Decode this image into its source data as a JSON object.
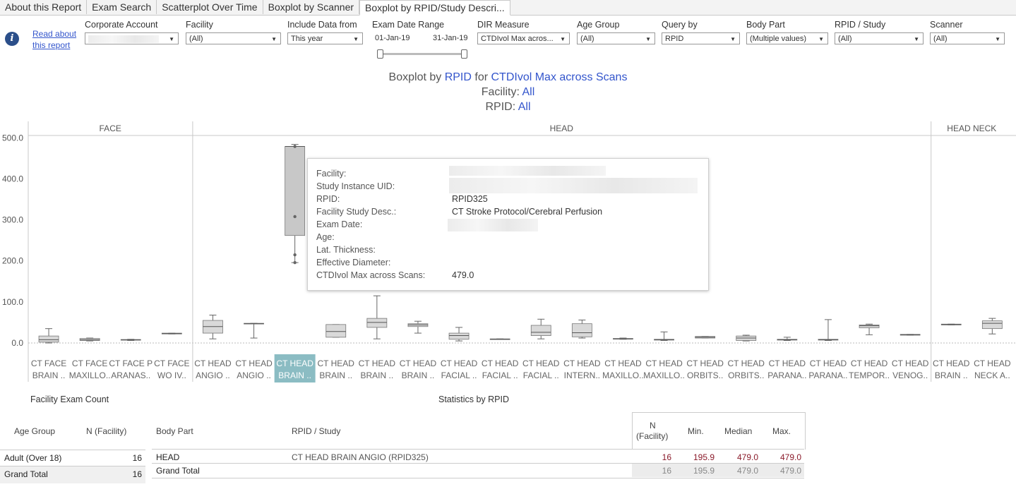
{
  "tabs": [
    "About this Report",
    "Exam Search",
    "Scatterplot Over Time",
    "Boxplot by Scanner",
    "Boxplot by RPID/Study Descri..."
  ],
  "active_tab": 4,
  "info_icon": "info-icon",
  "read_link": {
    "line1": "Read about",
    "line2": "this report"
  },
  "filters": {
    "corporate_account": {
      "label": "Corporate Account",
      "value": ""
    },
    "facility": {
      "label": "Facility",
      "value": "(All)"
    },
    "include_data": {
      "label": "Include Data from",
      "value": "This year"
    },
    "exam_date_range": {
      "label": "Exam Date Range",
      "start": "01-Jan-19",
      "end": "31-Jan-19"
    },
    "dir_measure": {
      "label": "DIR Measure",
      "value": "CTDIvol Max acros..."
    },
    "age_group": {
      "label": "Age Group",
      "value": "(All)"
    },
    "query_by": {
      "label": "Query by",
      "value": "RPID"
    },
    "body_part": {
      "label": "Body Part",
      "value": "(Multiple values)"
    },
    "rpid_study": {
      "label": "RPID / Study",
      "value": "(All)"
    },
    "scanner": {
      "label": "Scanner",
      "value": "(All)"
    }
  },
  "title": {
    "prefix": "Boxplot by ",
    "query": "RPID",
    "for": " for ",
    "measure": "CTDIvol Max across Scans",
    "facility_label": "Facility: ",
    "facility_value": "All",
    "rpid_label": "RPID: ",
    "rpid_value": "All"
  },
  "chart_data": {
    "type": "boxplot",
    "ylim": [
      -25,
      520
    ],
    "yticks": [
      0,
      100,
      200,
      300,
      400,
      500
    ],
    "ytick_labels": [
      "0.0",
      "100.0",
      "200.0",
      "300.0",
      "400.0",
      "500.0"
    ],
    "panels": [
      {
        "name": "FACE",
        "categories": [
          {
            "l1": "CT FACE",
            "l2": "BRAIN ..",
            "min": 0,
            "q1": 2,
            "median": 8,
            "q3": 17,
            "max": 35
          },
          {
            "l1": "CT FACE",
            "l2": "MAXILLO..",
            "min": 5,
            "q1": 6,
            "median": 8,
            "q3": 11,
            "max": 12
          },
          {
            "l1": "CT FACE P",
            "l2": "ARANAS..",
            "min": 6,
            "q1": 7,
            "median": 7.5,
            "q3": 8.5,
            "max": 9
          },
          {
            "l1": "CT FACE",
            "l2": "WO IV..",
            "min": 22,
            "q1": 22,
            "median": 23,
            "q3": 24,
            "max": 24
          }
        ]
      },
      {
        "name": "HEAD",
        "categories": [
          {
            "l1": "CT HEAD",
            "l2": "ANGIO ..",
            "min": 10,
            "q1": 24,
            "median": 40,
            "q3": 55,
            "max": 68
          },
          {
            "l1": "CT HEAD",
            "l2": "ANGIO ..",
            "min": 12,
            "q1": 47,
            "median": 47,
            "q3": 48,
            "max": 48
          },
          {
            "l1": "CT HEAD",
            "l2": "BRAIN ..",
            "min": 195.9,
            "q1": 262,
            "median": 479,
            "q3": 479,
            "max": 484,
            "selected": true,
            "points": [
              479,
              308,
              215,
              195.9
            ]
          },
          {
            "l1": "CT HEAD",
            "l2": "BRAIN ..",
            "min": 14,
            "q1": 14,
            "median": 28,
            "q3": 45,
            "max": 45
          },
          {
            "l1": "CT HEAD",
            "l2": "BRAIN ..",
            "min": 10,
            "q1": 38,
            "median": 50,
            "q3": 60,
            "max": 115
          },
          {
            "l1": "CT HEAD",
            "l2": "BRAIN ..",
            "min": 24,
            "q1": 40,
            "median": 44,
            "q3": 47,
            "max": 53
          },
          {
            "l1": "CT HEAD",
            "l2": "FACIAL ..",
            "min": 5,
            "q1": 9,
            "median": 18,
            "q3": 24,
            "max": 38
          },
          {
            "l1": "CT HEAD",
            "l2": "FACIAL ..",
            "min": 9,
            "q1": 9,
            "median": 9.5,
            "q3": 10,
            "max": 10
          },
          {
            "l1": "CT HEAD",
            "l2": "FACIAL ..",
            "min": 10,
            "q1": 18,
            "median": 26,
            "q3": 43,
            "max": 58
          },
          {
            "l1": "CT HEAD",
            "l2": "INTERN..",
            "min": 12,
            "q1": 15,
            "median": 25,
            "q3": 47,
            "max": 56
          },
          {
            "l1": "CT HEAD",
            "l2": "MAXILLO..",
            "min": 9,
            "q1": 9.5,
            "median": 10,
            "q3": 11,
            "max": 12
          },
          {
            "l1": "CT HEAD",
            "l2": "MAXILLO..",
            "min": 6,
            "q1": 7,
            "median": 8,
            "q3": 9,
            "max": 27
          },
          {
            "l1": "CT HEAD",
            "l2": "ORBITS..",
            "min": 12,
            "q1": 12,
            "median": 14,
            "q3": 16,
            "max": 16
          },
          {
            "l1": "CT HEAD",
            "l2": "ORBITS..",
            "min": 5,
            "q1": 6,
            "median": 12,
            "q3": 17,
            "max": 19
          },
          {
            "l1": "CT HEAD",
            "l2": "PARANA..",
            "min": 6,
            "q1": 7,
            "median": 8,
            "q3": 9,
            "max": 14
          },
          {
            "l1": "CT HEAD",
            "l2": "PARANA..",
            "min": 6,
            "q1": 7,
            "median": 8,
            "q3": 9,
            "max": 57
          },
          {
            "l1": "CT HEAD",
            "l2": "TEMPOR..",
            "min": 20,
            "q1": 37,
            "median": 42,
            "q3": 44,
            "max": 46
          },
          {
            "l1": "CT HEAD",
            "l2": "VENOG..",
            "min": 19,
            "q1": 19,
            "median": 20,
            "q3": 21,
            "max": 21
          }
        ]
      },
      {
        "name": "HEAD NECK",
        "categories": [
          {
            "l1": "CT HEAD",
            "l2": "BRAIN ..",
            "min": 44,
            "q1": 44,
            "median": 45,
            "q3": 46,
            "max": 46
          },
          {
            "l1": "CT HEAD",
            "l2": "NECK A..",
            "min": 22,
            "q1": 35,
            "median": 48,
            "q3": 54,
            "max": 60
          }
        ]
      }
    ]
  },
  "tooltip": {
    "rows": [
      {
        "label": "Facility:",
        "value": ""
      },
      {
        "label": "Study Instance UID:",
        "value": ""
      },
      {
        "label": "RPID:",
        "value": "RPID325"
      },
      {
        "label": "Facility Study Desc.:",
        "value": "CT Stroke Protocol/Cerebral Perfusion"
      },
      {
        "label": "Exam Date:",
        "value": ""
      },
      {
        "label": "Age:",
        "value": ""
      },
      {
        "label": "Lat. Thickness:",
        "value": ""
      },
      {
        "label": "Effective Diameter:",
        "value": ""
      },
      {
        "label": "CTDIvol Max across Scans:",
        "value": "479.0"
      }
    ]
  },
  "facility_count": {
    "title": "Facility Exam Count",
    "col_age": "Age Group",
    "col_n": "N (Facility)",
    "rows": [
      {
        "age": "Adult (Over 18)",
        "n": "16"
      }
    ],
    "total": {
      "label": "Grand Total",
      "n": "16"
    }
  },
  "stats": {
    "title": "Statistics by RPID",
    "col_body": "Body Part",
    "col_rpid": "RPID / Study",
    "col_n1": "N",
    "col_n2": "(Facility)",
    "col_min": "Min.",
    "col_median": "Median",
    "col_max": "Max.",
    "row": {
      "body": "HEAD",
      "rpid": "CT HEAD BRAIN ANGIO (RPID325)",
      "n": "16",
      "min": "195.9",
      "median": "479.0",
      "max": "479.0"
    },
    "total": {
      "label": "Grand Total",
      "n": "16",
      "min": "195.9",
      "median": "479.0",
      "max": "479.0"
    }
  }
}
